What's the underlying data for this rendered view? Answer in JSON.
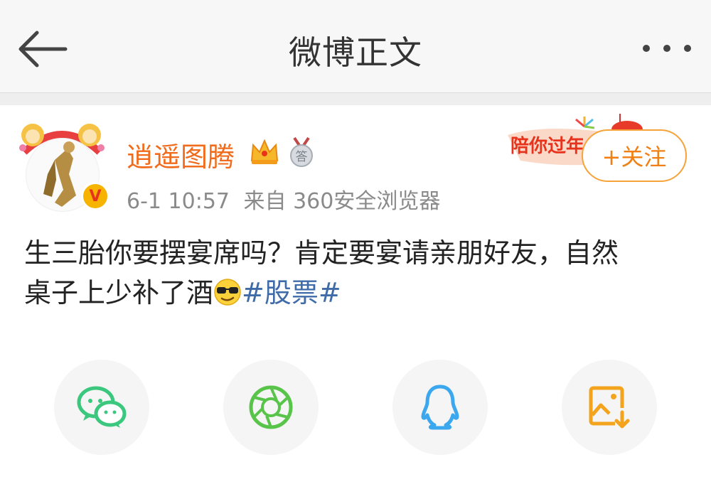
{
  "header": {
    "title": "微博正文",
    "back_icon": "arrow-left-icon",
    "more_icon": "more-dots-icon"
  },
  "post": {
    "username": "逍遥图腾",
    "badges": [
      "crown-icon",
      "medal-icon"
    ],
    "medal_text": "答",
    "verified_icon": "verified-v-icon",
    "date": "6-1 10:57",
    "source": "来自 360安全浏览器",
    "promo_text": "陪你过年",
    "follow_label": "+关注",
    "text_line1": "生三胎你要摆宴席吗？肯定要宴请亲朋好友，自然",
    "text_line2": "桌子上少补了酒",
    "hashtag": "#股票#"
  },
  "share": [
    {
      "name": "wechat",
      "icon": "wechat-icon",
      "color": "#3cc77e"
    },
    {
      "name": "moments",
      "icon": "moments-icon",
      "color": "#59c44a"
    },
    {
      "name": "qq",
      "icon": "qq-icon",
      "color": "#3aa7ee"
    },
    {
      "name": "save-image",
      "icon": "save-image-icon",
      "color": "#f3a31c"
    }
  ]
}
